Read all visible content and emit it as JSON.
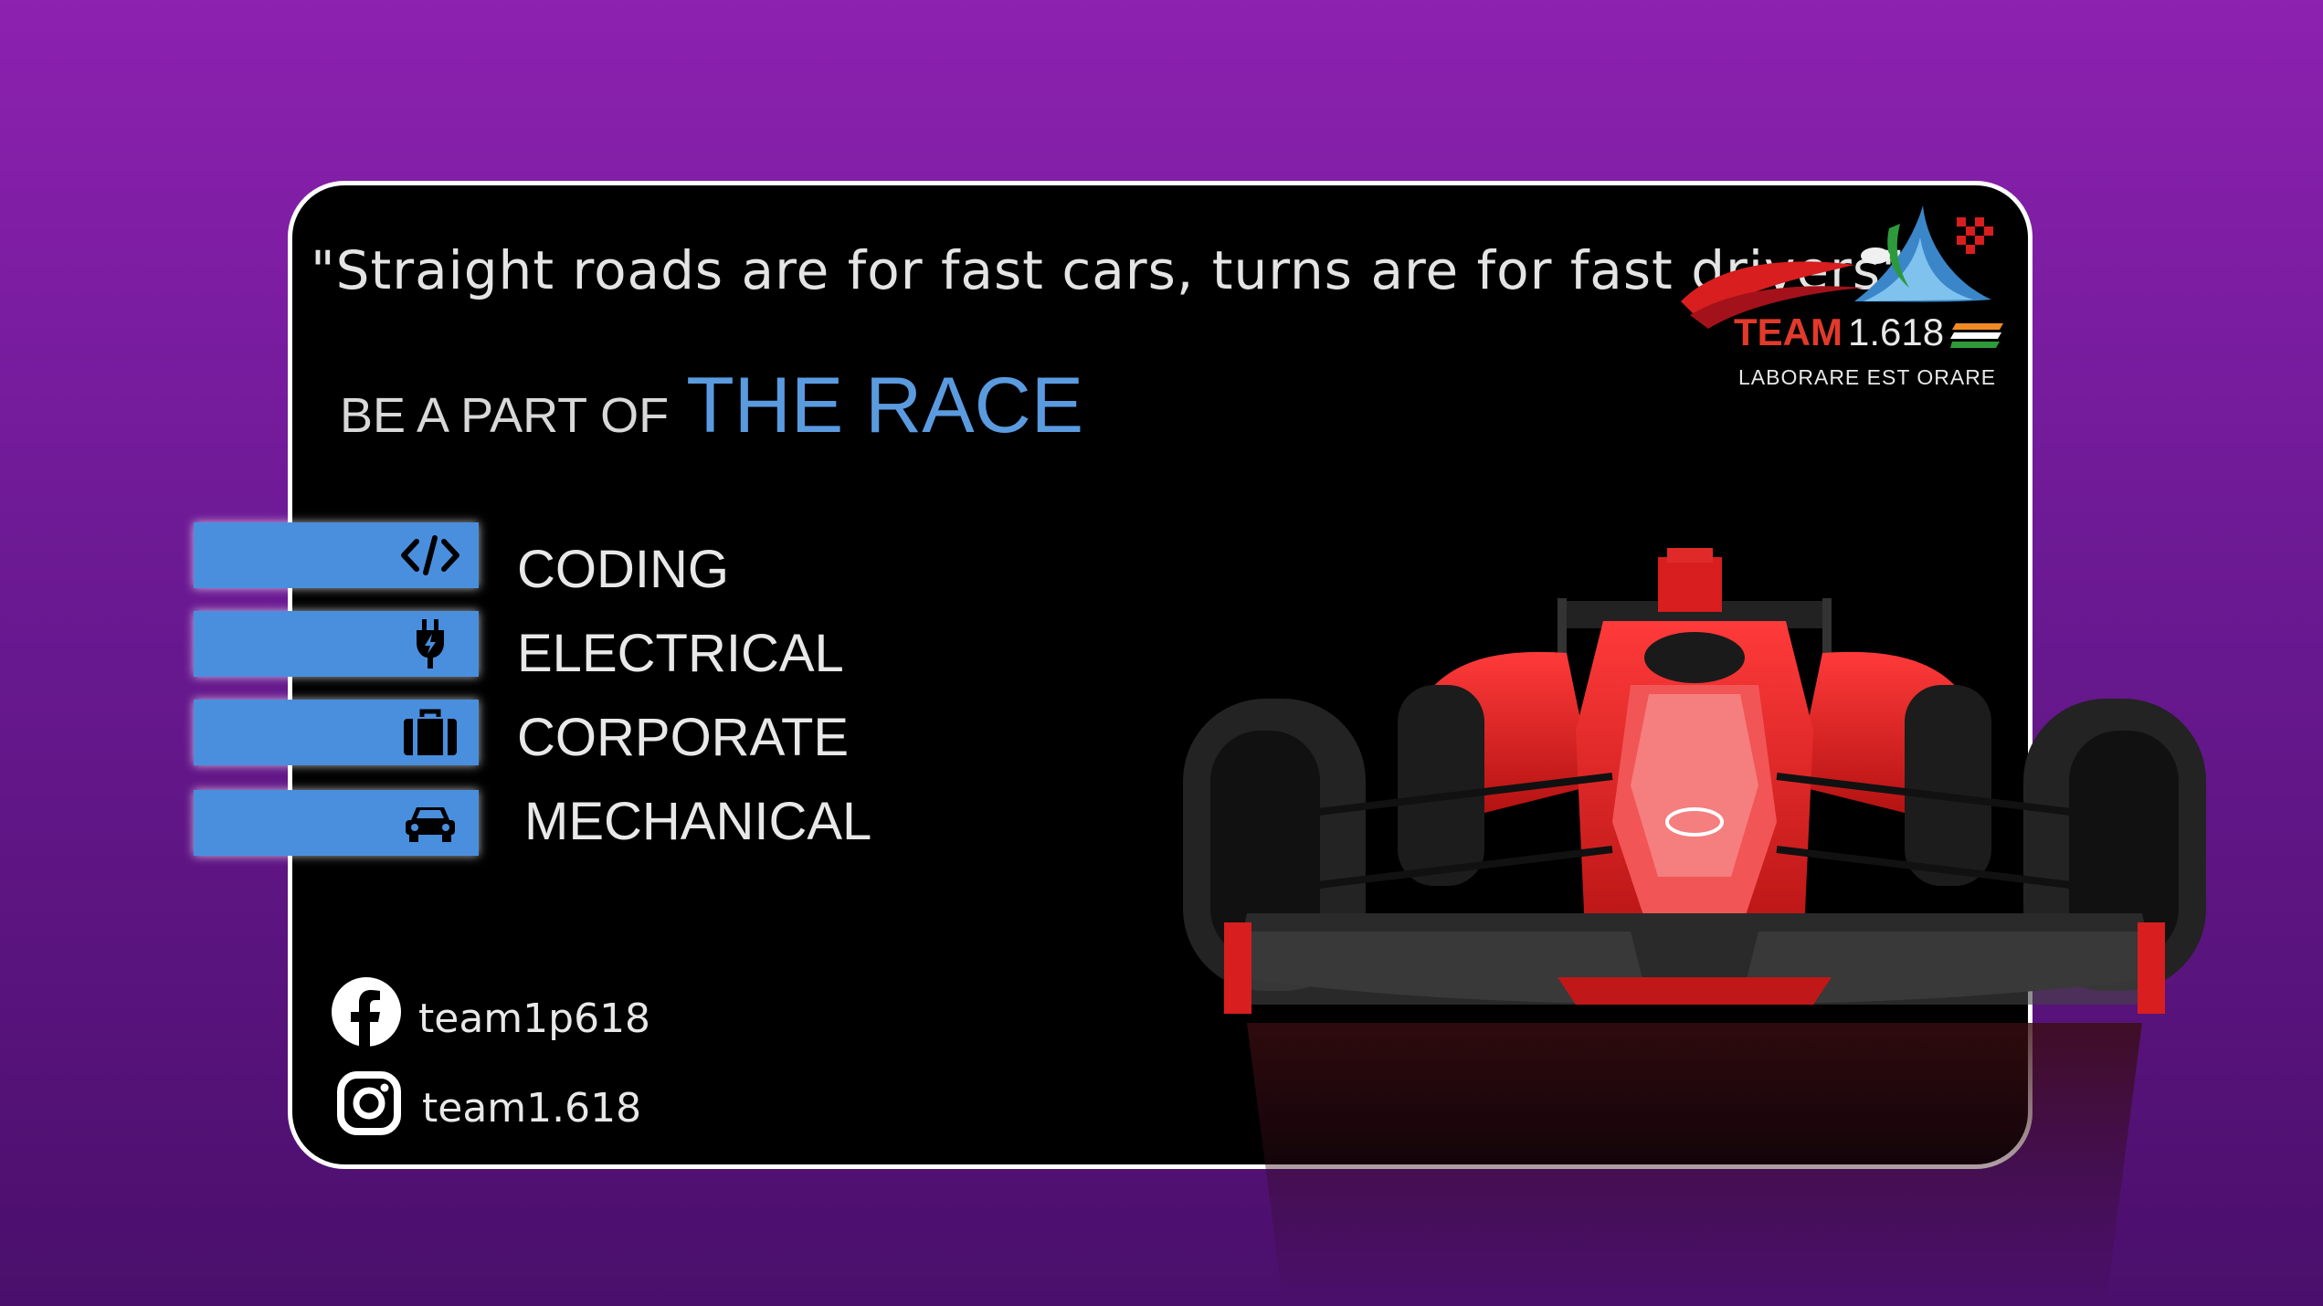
{
  "quote": "\"Straight roads are for fast cars, turns are for fast drivers\"",
  "tagline": {
    "prefix": "BE A PART OF",
    "highlight": "THE RACE"
  },
  "logo": {
    "team_word": "TEAM",
    "team_number": "1.618",
    "motto": "LABORARE  EST  ORARE"
  },
  "departments": [
    {
      "label": "CODING",
      "icon": "code-icon"
    },
    {
      "label": "ELECTRICAL",
      "icon": "plug-icon"
    },
    {
      "label": "CORPORATE",
      "icon": "briefcase-icon"
    },
    {
      "label": "MECHANICAL",
      "icon": "car-icon"
    }
  ],
  "social": {
    "facebook": {
      "handle": "team1p618",
      "icon": "facebook-icon"
    },
    "instagram": {
      "handle": "team1.618",
      "icon": "instagram-icon"
    }
  },
  "colors": {
    "accent_blue": "#4a8fde",
    "highlight_blue": "#5a9be0",
    "card_background": "#000000",
    "car_red": "#d81e1e"
  }
}
